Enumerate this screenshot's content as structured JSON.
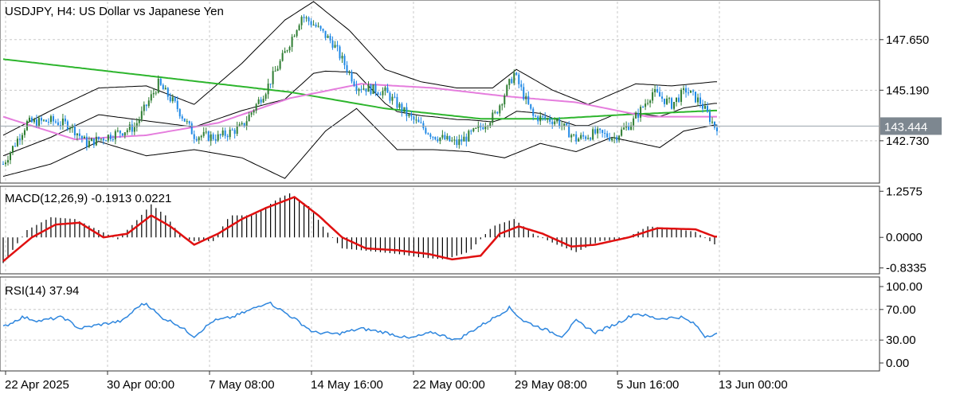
{
  "colors": {
    "bull": "#2e7d32",
    "bear": "#1e88e5",
    "ma_long": "#2db52d",
    "ma_mid": "#e57ddd",
    "bands": "#000000",
    "macd_signal": "#e01010",
    "macd_hist": "#000000",
    "rsi": "#2e86de",
    "grid": "#c8c8c8",
    "price_tag_bg": "#7d8790",
    "price_line": "#9aa3ab"
  },
  "chart_data": [
    {
      "type": "candlestick",
      "title": "USDJPY, H4:  US Dollar vs Japanese Yen",
      "ylim": [
        140.75,
        149.5
      ],
      "y_ticks": [
        "147.650",
        "145.190",
        "142.730"
      ],
      "current_price": "143.444",
      "x_ticks": [
        "22 Apr 2025",
        "30 Apr 00:00",
        "7 May 08:00",
        "14 May 16:00",
        "22 May 00:00",
        "29 May 08:00",
        "5 Jun 16:00",
        "13 Jun 00:00"
      ],
      "close_anchors": [
        [
          0,
          141.6
        ],
        [
          10,
          143.6
        ],
        [
          20,
          143.7
        ],
        [
          28,
          143.5
        ],
        [
          35,
          142.6
        ],
        [
          45,
          143.0
        ],
        [
          55,
          143.4
        ],
        [
          65,
          145.5
        ],
        [
          72,
          144.5
        ],
        [
          80,
          143.0
        ],
        [
          90,
          142.9
        ],
        [
          100,
          143.4
        ],
        [
          110,
          145.2
        ],
        [
          118,
          147.0
        ],
        [
          125,
          148.8
        ],
        [
          130,
          148.4
        ],
        [
          138,
          147.5
        ],
        [
          148,
          145.4
        ],
        [
          160,
          145.1
        ],
        [
          170,
          143.9
        ],
        [
          180,
          143.0
        ],
        [
          190,
          142.6
        ],
        [
          198,
          143.2
        ],
        [
          206,
          144.0
        ],
        [
          214,
          146.0
        ],
        [
          222,
          143.9
        ],
        [
          232,
          143.7
        ],
        [
          240,
          142.8
        ],
        [
          248,
          143.1
        ],
        [
          256,
          142.9
        ],
        [
          264,
          143.7
        ],
        [
          272,
          145.1
        ],
        [
          280,
          144.5
        ],
        [
          286,
          145.2
        ],
        [
          292,
          144.6
        ],
        [
          298,
          143.44
        ]
      ],
      "moving_averages": [
        {
          "name": "long",
          "points": [
            [
              0,
              146.7
            ],
            [
              60,
              145.9
            ],
            [
              120,
              145.1
            ],
            [
              160,
              144.3
            ],
            [
              200,
              143.8
            ],
            [
              230,
              143.8
            ],
            [
              260,
              144.0
            ],
            [
              298,
              144.2
            ]
          ]
        },
        {
          "name": "mid",
          "points": [
            [
              0,
              143.9
            ],
            [
              30,
              142.8
            ],
            [
              60,
              143.0
            ],
            [
              90,
              143.6
            ],
            [
              120,
              144.8
            ],
            [
              150,
              145.5
            ],
            [
              180,
              145.3
            ],
            [
              210,
              144.9
            ],
            [
              240,
              144.6
            ],
            [
              270,
              143.9
            ],
            [
              298,
              143.9
            ]
          ]
        }
      ],
      "bands": {
        "upper": [
          [
            0,
            143.0
          ],
          [
            20,
            144.2
          ],
          [
            40,
            145.3
          ],
          [
            60,
            145.4
          ],
          [
            80,
            144.5
          ],
          [
            100,
            146.5
          ],
          [
            118,
            148.6
          ],
          [
            130,
            149.5
          ],
          [
            145,
            148.1
          ],
          [
            160,
            146.2
          ],
          [
            175,
            145.6
          ],
          [
            190,
            145.3
          ],
          [
            205,
            145.3
          ],
          [
            215,
            146.2
          ],
          [
            230,
            145.2
          ],
          [
            245,
            144.5
          ],
          [
            265,
            145.5
          ],
          [
            280,
            145.4
          ],
          [
            298,
            145.6
          ]
        ],
        "lower": [
          [
            0,
            141.0
          ],
          [
            20,
            141.6
          ],
          [
            40,
            142.7
          ],
          [
            60,
            142.0
          ],
          [
            80,
            142.3
          ],
          [
            100,
            141.9
          ],
          [
            118,
            140.9
          ],
          [
            135,
            143.2
          ],
          [
            148,
            144.3
          ],
          [
            165,
            142.3
          ],
          [
            180,
            142.3
          ],
          [
            195,
            142.2
          ],
          [
            210,
            141.9
          ],
          [
            225,
            142.6
          ],
          [
            240,
            142.2
          ],
          [
            255,
            142.9
          ],
          [
            275,
            142.4
          ],
          [
            285,
            143.2
          ],
          [
            298,
            143.5
          ]
        ]
      }
    },
    {
      "type": "bar",
      "title": "MACD(12,26,9) -0.1913 0.0221",
      "ylim": [
        -0.95,
        1.35
      ],
      "y_ticks": [
        "1.2575",
        "0.0000",
        "-0.8335"
      ],
      "hist_anchors": [
        [
          0,
          -0.7
        ],
        [
          10,
          0.2
        ],
        [
          20,
          0.55
        ],
        [
          30,
          0.5
        ],
        [
          40,
          0.2
        ],
        [
          48,
          -0.05
        ],
        [
          55,
          0.4
        ],
        [
          62,
          0.9
        ],
        [
          68,
          0.6
        ],
        [
          75,
          0.0
        ],
        [
          80,
          -0.1
        ],
        [
          88,
          -0.1
        ],
        [
          95,
          0.6
        ],
        [
          105,
          0.6
        ],
        [
          115,
          1.05
        ],
        [
          120,
          1.2
        ],
        [
          128,
          0.85
        ],
        [
          135,
          0.2
        ],
        [
          142,
          -0.3
        ],
        [
          150,
          -0.35
        ],
        [
          165,
          -0.45
        ],
        [
          175,
          -0.55
        ],
        [
          185,
          -0.6
        ],
        [
          195,
          -0.4
        ],
        [
          205,
          0.3
        ],
        [
          214,
          0.5
        ],
        [
          222,
          0.1
        ],
        [
          232,
          -0.2
        ],
        [
          240,
          -0.4
        ],
        [
          250,
          -0.1
        ],
        [
          260,
          -0.05
        ],
        [
          270,
          0.3
        ],
        [
          280,
          0.25
        ],
        [
          290,
          0.15
        ],
        [
          298,
          -0.19
        ]
      ],
      "signal_anchors": [
        [
          0,
          -0.65
        ],
        [
          12,
          0.0
        ],
        [
          22,
          0.35
        ],
        [
          32,
          0.4
        ],
        [
          42,
          0.0
        ],
        [
          52,
          0.1
        ],
        [
          62,
          0.6
        ],
        [
          70,
          0.3
        ],
        [
          80,
          -0.2
        ],
        [
          90,
          0.1
        ],
        [
          100,
          0.5
        ],
        [
          110,
          0.8
        ],
        [
          122,
          1.1
        ],
        [
          132,
          0.6
        ],
        [
          142,
          0.0
        ],
        [
          152,
          -0.3
        ],
        [
          165,
          -0.35
        ],
        [
          178,
          -0.45
        ],
        [
          188,
          -0.6
        ],
        [
          200,
          -0.5
        ],
        [
          208,
          0.1
        ],
        [
          216,
          0.3
        ],
        [
          226,
          0.1
        ],
        [
          238,
          -0.25
        ],
        [
          248,
          -0.2
        ],
        [
          262,
          0.0
        ],
        [
          274,
          0.25
        ],
        [
          290,
          0.22
        ],
        [
          298,
          0.02
        ]
      ]
    },
    {
      "type": "line",
      "title": "RSI(14) 37.94",
      "ylim": [
        0,
        100
      ],
      "y_ticks": [
        "100.00",
        "70.00",
        "30.00",
        "0.00"
      ],
      "levels": [
        70,
        30
      ],
      "rsi_anchors": [
        [
          0,
          47
        ],
        [
          8,
          60
        ],
        [
          15,
          55
        ],
        [
          25,
          60
        ],
        [
          32,
          45
        ],
        [
          40,
          50
        ],
        [
          50,
          55
        ],
        [
          57,
          75
        ],
        [
          60,
          78
        ],
        [
          66,
          60
        ],
        [
          72,
          52
        ],
        [
          80,
          35
        ],
        [
          88,
          55
        ],
        [
          96,
          60
        ],
        [
          104,
          70
        ],
        [
          111,
          80
        ],
        [
          116,
          70
        ],
        [
          122,
          58
        ],
        [
          130,
          40
        ],
        [
          140,
          38
        ],
        [
          150,
          45
        ],
        [
          160,
          40
        ],
        [
          170,
          32
        ],
        [
          180,
          40
        ],
        [
          190,
          30
        ],
        [
          198,
          45
        ],
        [
          206,
          60
        ],
        [
          212,
          72
        ],
        [
          218,
          55
        ],
        [
          226,
          45
        ],
        [
          234,
          35
        ],
        [
          240,
          55
        ],
        [
          248,
          40
        ],
        [
          256,
          50
        ],
        [
          265,
          65
        ],
        [
          274,
          58
        ],
        [
          284,
          60
        ],
        [
          290,
          50
        ],
        [
          294,
          35
        ],
        [
          298,
          37.94
        ]
      ]
    }
  ]
}
